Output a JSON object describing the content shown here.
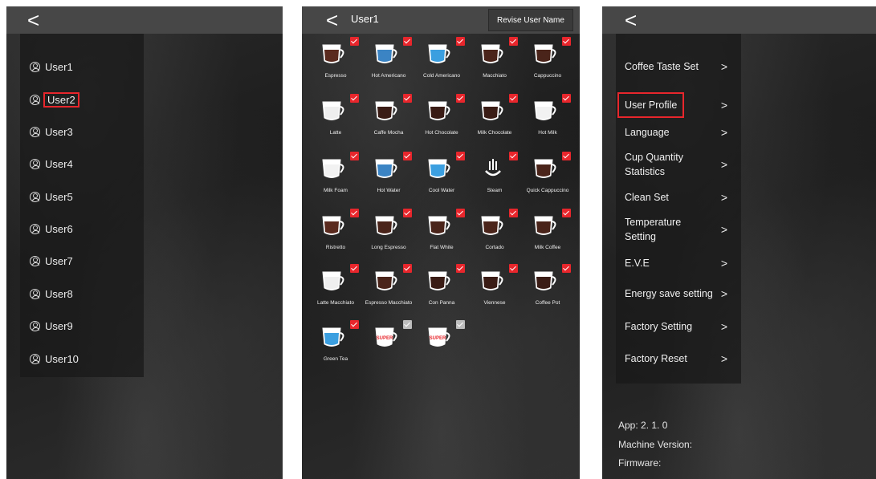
{
  "panel1": {
    "back_icon": "<",
    "users": [
      {
        "label": "User1"
      },
      {
        "label": "User2",
        "selected": true
      },
      {
        "label": "User3"
      },
      {
        "label": "User4"
      },
      {
        "label": "User5"
      },
      {
        "label": "User6"
      },
      {
        "label": "User7"
      },
      {
        "label": "User8"
      },
      {
        "label": "User9"
      },
      {
        "label": "User10"
      }
    ]
  },
  "panel2": {
    "back_icon": "<",
    "title": "User1",
    "revise_button": "Revise User Name",
    "drinks": [
      {
        "label": "Espresso",
        "fill": "#5a2a1e",
        "checked": true
      },
      {
        "label": "Hot Americano",
        "fill": "#3b84c4",
        "checked": true
      },
      {
        "label": "Cold Americano",
        "fill": "#3b9fe0",
        "checked": true
      },
      {
        "label": "Macchiato",
        "fill": "#4a241a",
        "checked": true
      },
      {
        "label": "Cappuccino",
        "fill": "#4a241a",
        "checked": true
      },
      {
        "label": "Latte",
        "fill": "#efefef",
        "checked": true
      },
      {
        "label": "Caffe Mocha",
        "fill": "#3a1c15",
        "checked": true
      },
      {
        "label": "Hot Chocolate",
        "fill": "#3a1c15",
        "checked": true
      },
      {
        "label": "Milk Chocolate",
        "fill": "#3a1c15",
        "checked": true
      },
      {
        "label": "Hot Milk",
        "fill": "#f2f2f2",
        "checked": true
      },
      {
        "label": "Milk Foam",
        "fill": "#f2f2f2",
        "checked": true
      },
      {
        "label": "Hot Water",
        "fill": "#3b84c4",
        "checked": true
      },
      {
        "label": "Cool Water",
        "fill": "#3b9fe0",
        "checked": true
      },
      {
        "label": "Steam",
        "fill": "none",
        "checked": true
      },
      {
        "label": "Quick Cappuccino",
        "fill": "#4a241a",
        "checked": true
      },
      {
        "label": "Ristretto",
        "fill": "#5a2a1e",
        "checked": true
      },
      {
        "label": "Long Espresso",
        "fill": "#4a241a",
        "checked": true
      },
      {
        "label": "Flat White",
        "fill": "#4a241a",
        "checked": true
      },
      {
        "label": "Cortado",
        "fill": "#4a241a",
        "checked": true
      },
      {
        "label": "Milk Coffee",
        "fill": "#4a241a",
        "checked": true
      },
      {
        "label": "Latte Macchiato",
        "fill": "#efefef",
        "checked": true
      },
      {
        "label": "Espresso Macchiato",
        "fill": "#4a241a",
        "checked": true
      },
      {
        "label": "Con Panna",
        "fill": "#3a1c15",
        "checked": true
      },
      {
        "label": "Viennese",
        "fill": "#3a1c15",
        "checked": true
      },
      {
        "label": "Coffee Pot",
        "fill": "#3a1c15",
        "checked": true
      },
      {
        "label": "Green Tea",
        "fill": "#3b9fe0",
        "checked": true
      },
      {
        "label": "",
        "fill": "#ffffff",
        "checked": false,
        "badge": "SUPER"
      },
      {
        "label": "",
        "fill": "#ffffff",
        "checked": false,
        "badge": "SUPER"
      }
    ]
  },
  "panel3": {
    "back_icon": "<",
    "chevron": ">",
    "menu": [
      {
        "label": "Coffee Taste Set"
      },
      {
        "label": "User Profile",
        "selected": true
      },
      {
        "label": "Language"
      },
      {
        "label": "Cup Quantity Statistics"
      },
      {
        "label": "Clean Set"
      },
      {
        "label": "Temperature Setting"
      },
      {
        "label": "E.V.E"
      },
      {
        "label": "Energy save setting"
      },
      {
        "label": "Factory Setting"
      },
      {
        "label": "Factory Reset"
      }
    ],
    "app_version": "App: 2. 1. 0",
    "machine_version": "Machine Version:",
    "firmware": "Firmware:"
  },
  "colors": {
    "accent_red": "#e8262c",
    "topbar": "#474747"
  }
}
